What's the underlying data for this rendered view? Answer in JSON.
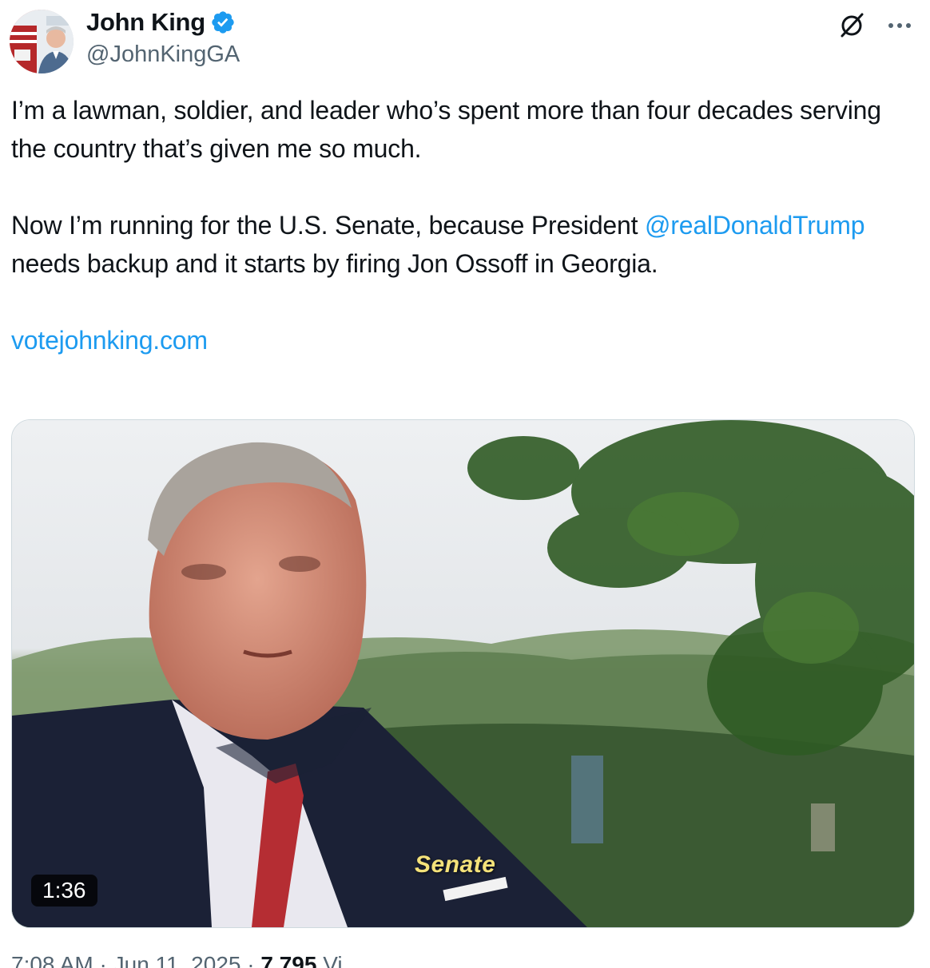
{
  "author": {
    "display_name": "John King",
    "handle": "@JohnKingGA",
    "verified": true,
    "avatar_icon": "avatar-photo"
  },
  "actions": {
    "grok_icon": "grok-icon",
    "more_icon": "more-options-icon"
  },
  "tweet": {
    "paragraph1": "I’m a lawman, soldier, and leader who’s spent more than four decades serving the country that’s given me so much.",
    "paragraph2_before": "Now I’m running for the U.S. Senate, because President ",
    "mention": "@realDonaldTrump",
    "paragraph2_after": " needs backup and it starts by firing Jon Ossoff in Georgia.",
    "url": "votejohnking.com"
  },
  "media": {
    "duration": "1:36",
    "caption": "Senate"
  },
  "meta": {
    "time": "7:08 AM",
    "separator": " · ",
    "date": "Jun 11, 2025",
    "views_count": "7,795",
    "views_label": " Vi"
  },
  "colors": {
    "link": "#1d9bf0",
    "verified": "#1d9bf0",
    "text": "#0f1419",
    "secondary": "#536471"
  }
}
